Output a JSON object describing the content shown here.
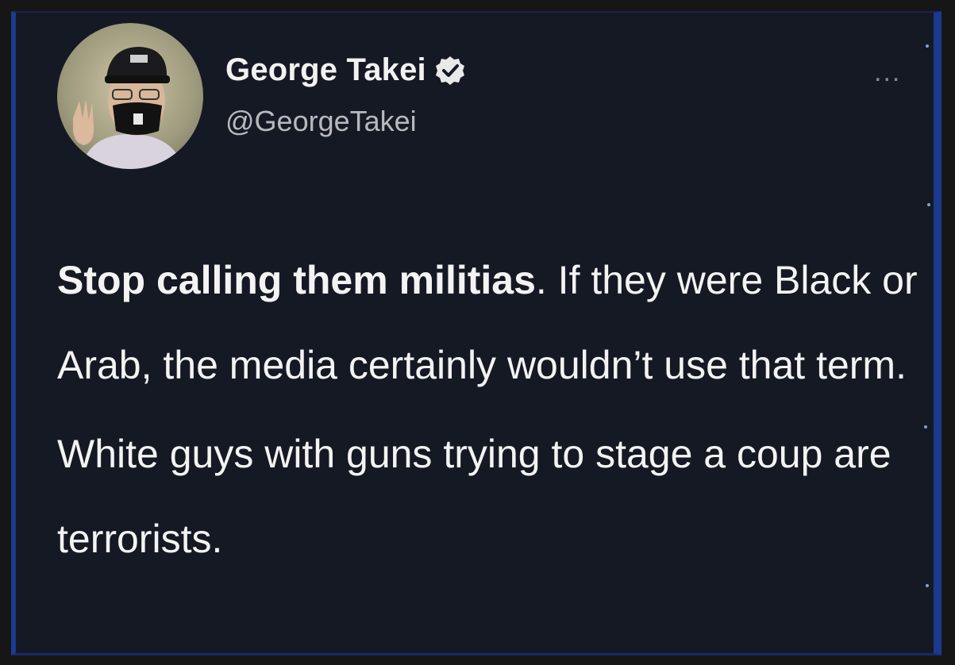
{
  "profile": {
    "display_name": "George Takei",
    "handle": "@GeorgeTakei",
    "verified_icon": "verified-badge-icon",
    "more_icon": "more-options-icon",
    "more_glyph": "..."
  },
  "tweet": {
    "bold_part": "Stop calling them militias",
    "line1_rest": ". If they were Black or Arab, the media certainly wouldn’t use that term.",
    "paragraph2": "White guys with guns trying to stage a coup are terrorists."
  },
  "colors": {
    "background": "#151924",
    "frame_border": "#1c3b8c",
    "text": "#f3f3f3",
    "handle": "#b8b9bd",
    "verified": "#e9e9e9"
  }
}
